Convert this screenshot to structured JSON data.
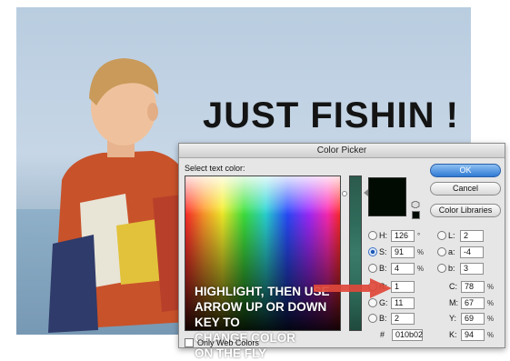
{
  "headline": "JUST FISHIN !",
  "dialog": {
    "title": "Color Picker",
    "prompt": "Select text color:",
    "overlay_text": "HIGHLIGHT, THEN USE\nARROW UP OR DOWN\nKEY TO\nCHANGE COLOR\nON THE FLY",
    "buttons": {
      "ok": "OK",
      "cancel": "Cancel",
      "libraries": "Color Libraries"
    },
    "hsb": {
      "h": {
        "label": "H:",
        "value": "126",
        "unit": "°"
      },
      "s": {
        "label": "S:",
        "value": "91",
        "unit": "%"
      },
      "b": {
        "label": "B:",
        "value": "4",
        "unit": "%"
      }
    },
    "lab": {
      "l": {
        "label": "L:",
        "value": "2"
      },
      "a": {
        "label": "a:",
        "value": "-4"
      },
      "b": {
        "label": "b:",
        "value": "3"
      }
    },
    "rgb": {
      "r": {
        "label": "R:",
        "value": "1"
      },
      "g": {
        "label": "G:",
        "value": "11"
      },
      "b": {
        "label": "B:",
        "value": "2"
      }
    },
    "cmyk": {
      "c": {
        "label": "C:",
        "value": "78",
        "unit": "%"
      },
      "m": {
        "label": "M:",
        "value": "67",
        "unit": "%"
      },
      "y": {
        "label": "Y:",
        "value": "69",
        "unit": "%"
      },
      "k": {
        "label": "K:",
        "value": "94",
        "unit": "%"
      }
    },
    "hex": {
      "label": "#",
      "value": "010b02"
    },
    "only_web_colors": "Only Web Colors",
    "selected_color": "#010b02",
    "active_channel": "S"
  }
}
